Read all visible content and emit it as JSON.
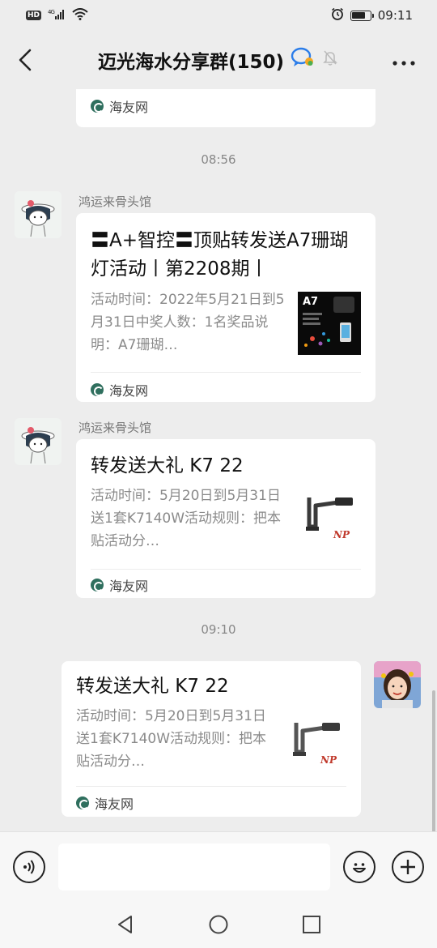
{
  "status_bar": {
    "hd": "HD",
    "network": "4G",
    "time": "09:11",
    "battery_level": 0.75
  },
  "nav": {
    "title": "迈光海水分享群(150)"
  },
  "messages": [
    {
      "source": "海友网"
    },
    {
      "time": "08:56",
      "sender": "鸿运来骨头馆",
      "title": "〓A+智控〓顶贴转发送A7珊瑚灯活动丨第2208期丨",
      "desc": "活动时间：2022年5月21日到5月31日中奖人数：1名奖品说明：A7珊瑚…",
      "thumb_label": "A7",
      "source": "海友网"
    },
    {
      "sender": "鸿运来骨头馆",
      "title": "转发送大礼 K7 22",
      "desc": "活动时间：5月20日到5月31日送1套K7140W活动规则：把本贴活动分…",
      "source": "海友网"
    },
    {
      "time": "09:10",
      "title": "转发送大礼 K7 22",
      "desc": "活动时间：5月20日到5月31日送1套K7140W活动规则：把本贴活动分…",
      "source": "海友网"
    }
  ],
  "input": {
    "placeholder": ""
  },
  "colors": {
    "background": "#ededed",
    "card": "#ffffff",
    "timestamp": "#888888",
    "description": "#8a8a8a",
    "source_logo": "#2f6f5e"
  },
  "icons": [
    "hd-icon",
    "signal-icon",
    "wifi-icon",
    "alarm-icon",
    "battery-icon",
    "back-icon",
    "group-chat-icon",
    "mute-bell-icon",
    "more-icon",
    "voice-icon",
    "emoji-icon",
    "plus-icon",
    "nav-back-icon",
    "nav-home-icon",
    "nav-recents-icon"
  ]
}
